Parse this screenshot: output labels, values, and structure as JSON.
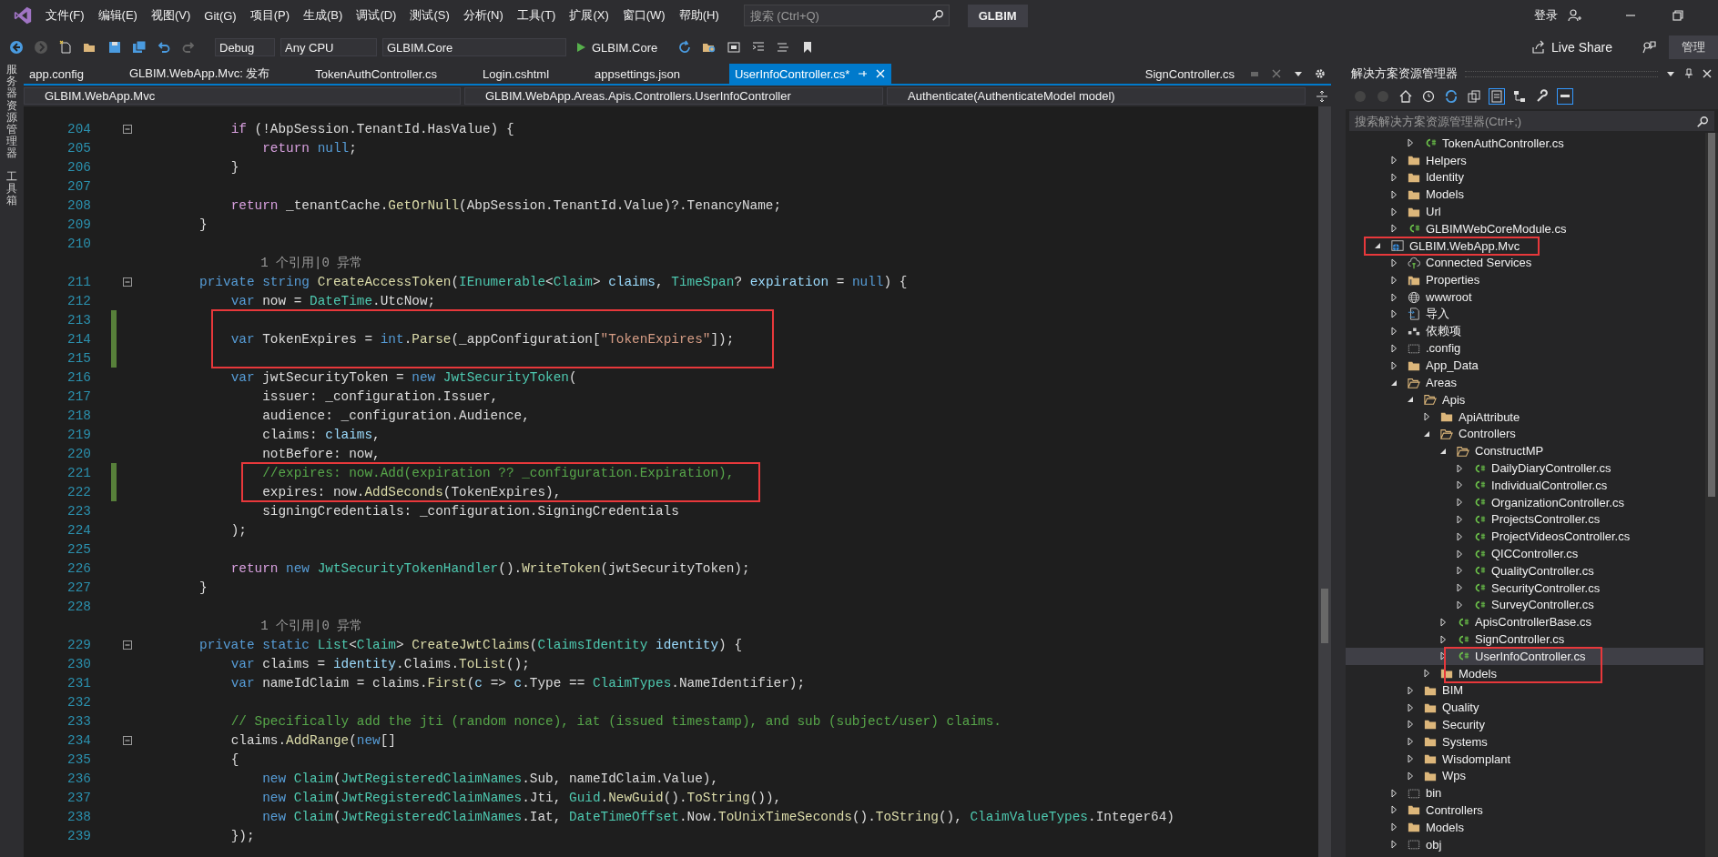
{
  "menu_bar": {
    "items": [
      "文件(F)",
      "编辑(E)",
      "视图(V)",
      "Git(G)",
      "项目(P)",
      "生成(B)",
      "调试(D)",
      "测试(S)",
      "分析(N)",
      "工具(T)",
      "扩展(X)",
      "窗口(W)",
      "帮助(H)"
    ],
    "search": {
      "placeholder": "搜索 (Ctrl+Q)"
    },
    "solution_name": "GLBIM",
    "sign_in": "登录"
  },
  "toolbar": {
    "configuration": "Debug",
    "platform": "Any CPU",
    "startup_project": "GLBIM.Core",
    "run": "GLBIM.Core",
    "live_share": "Live Share",
    "admin": "管理"
  },
  "side_tabs": [
    "服务器资源管理器",
    "工具箱"
  ],
  "editor": {
    "tabs": [
      {
        "label": "app.config",
        "selected": false
      },
      {
        "label": "GLBIM.WebApp.Mvc: 发布",
        "selected": false
      },
      {
        "label": "TokenAuthController.cs",
        "selected": false
      },
      {
        "label": "Login.cshtml",
        "selected": false
      },
      {
        "label": "appsettings.json",
        "selected": false
      },
      {
        "label": "UserInfoController.cs*",
        "selected": true
      }
    ],
    "preview_tab": "SignController.cs",
    "nav": [
      "GLBIM.WebApp.Mvc",
      "GLBIM.WebApp.Areas.Apis.Controllers.UserInfoController",
      "Authenticate(AuthenticateModel model)"
    ],
    "lines": [
      {
        "kind": "code",
        "number": "204",
        "changed": false,
        "fold": true,
        "boxed": false,
        "s": [
          {
            "kind": "control",
            "text": "if"
          },
          {
            "kind": "plain",
            "text": " (!AbpSession.TenantId.HasValue) {"
          }
        ]
      },
      {
        "kind": "code",
        "number": "205",
        "changed": false,
        "fold": false,
        "boxed": false,
        "s": [
          {
            "kind": "control",
            "text": "return "
          },
          {
            "kind": "keyword",
            "text": "null"
          },
          {
            "kind": "plain",
            "text": ";"
          }
        ]
      },
      {
        "kind": "code",
        "number": "206",
        "changed": false,
        "fold": false,
        "boxed": false,
        "s": [
          {
            "kind": "plain",
            "text": "}"
          }
        ]
      },
      {
        "kind": "code",
        "number": "207",
        "changed": false,
        "fold": false,
        "boxed": false
      },
      {
        "kind": "code",
        "number": "208",
        "changed": false,
        "fold": false,
        "boxed": false,
        "s": [
          {
            "kind": "control",
            "text": "return "
          },
          {
            "kind": "plain",
            "text": "_tenantCache."
          },
          {
            "kind": "method",
            "text": "GetOrNull"
          },
          {
            "kind": "plain",
            "text": "(AbpSession.TenantId.Value)?.TenancyName;"
          }
        ]
      },
      {
        "kind": "code",
        "number": "209",
        "changed": false,
        "fold": false,
        "boxed": false,
        "s": [
          {
            "kind": "plain",
            "text": "}"
          }
        ]
      },
      {
        "kind": "code",
        "number": "210",
        "changed": false,
        "fold": false,
        "boxed": false
      },
      {
        "kind": "lens",
        "text": "1 个引用|0 异常",
        "boxed": false
      },
      {
        "kind": "code",
        "number": "211",
        "changed": false,
        "fold": true,
        "boxed": false,
        "s": [
          {
            "kind": "keyword",
            "text": "private string "
          },
          {
            "kind": "method",
            "text": "CreateAccessToken"
          },
          {
            "kind": "plain",
            "text": "("
          },
          {
            "kind": "type",
            "text": "IEnumerable"
          },
          {
            "kind": "plain",
            "text": "<"
          },
          {
            "kind": "type",
            "text": "Claim"
          },
          {
            "kind": "plain",
            "text": "> "
          },
          {
            "kind": "local",
            "text": "claims"
          },
          {
            "kind": "plain",
            "text": ", "
          },
          {
            "kind": "type",
            "text": "TimeSpan"
          },
          {
            "kind": "plain",
            "text": "? "
          },
          {
            "kind": "local",
            "text": "expiration"
          },
          {
            "kind": "plain",
            "text": " = "
          },
          {
            "kind": "keyword",
            "text": "null"
          },
          {
            "kind": "plain",
            "text": ") {"
          }
        ]
      },
      {
        "kind": "code",
        "number": "212",
        "changed": false,
        "fold": false,
        "boxed": false,
        "s": [
          {
            "kind": "keyword",
            "text": "var "
          },
          {
            "kind": "plain",
            "text": "now = "
          },
          {
            "kind": "type",
            "text": "DateTime"
          },
          {
            "kind": "plain",
            "text": ".UtcNow;"
          }
        ]
      },
      {
        "kind": "code",
        "number": "213",
        "changed": true,
        "fold": false,
        "boxed": true
      },
      {
        "kind": "code",
        "number": "214",
        "changed": true,
        "fold": false,
        "boxed": true,
        "s": [
          {
            "kind": "keyword",
            "text": "var "
          },
          {
            "kind": "plain",
            "text": "TokenExpires = "
          },
          {
            "kind": "keyword",
            "text": "int"
          },
          {
            "kind": "plain",
            "text": "."
          },
          {
            "kind": "method",
            "text": "Parse"
          },
          {
            "kind": "plain",
            "text": "(_appConfiguration["
          },
          {
            "kind": "string",
            "text": "\"TokenExpires\""
          },
          {
            "kind": "plain",
            "text": "]);"
          }
        ]
      },
      {
        "kind": "code",
        "number": "215",
        "changed": true,
        "fold": false,
        "boxed": true
      },
      {
        "kind": "code",
        "number": "216",
        "changed": false,
        "fold": false,
        "boxed": false,
        "s": [
          {
            "kind": "keyword",
            "text": "var "
          },
          {
            "kind": "plain",
            "text": "jwtSecurityToken = "
          },
          {
            "kind": "keyword",
            "text": "new "
          },
          {
            "kind": "type",
            "text": "JwtSecurityToken"
          },
          {
            "kind": "plain",
            "text": "("
          }
        ]
      },
      {
        "kind": "code",
        "number": "217",
        "changed": false,
        "fold": false,
        "boxed": false,
        "s": [
          {
            "kind": "plain",
            "text": "issuer: _configuration.Issuer,"
          }
        ]
      },
      {
        "kind": "code",
        "number": "218",
        "changed": false,
        "fold": false,
        "boxed": false,
        "s": [
          {
            "kind": "plain",
            "text": "audience: _configuration.Audience,"
          }
        ]
      },
      {
        "kind": "code",
        "number": "219",
        "changed": false,
        "fold": false,
        "boxed": false,
        "s": [
          {
            "kind": "plain",
            "text": "claims: "
          },
          {
            "kind": "local",
            "text": "claims"
          },
          {
            "kind": "plain",
            "text": ","
          }
        ]
      },
      {
        "kind": "code",
        "number": "220",
        "changed": false,
        "fold": false,
        "boxed": false,
        "s": [
          {
            "kind": "plain",
            "text": "notBefore: now,"
          }
        ]
      },
      {
        "kind": "code",
        "number": "221",
        "changed": true,
        "fold": false,
        "boxed": true,
        "s": [
          {
            "kind": "comment",
            "text": "//expires: now.Add(expiration ?? _configuration.Expiration),"
          }
        ]
      },
      {
        "kind": "code",
        "number": "222",
        "changed": true,
        "fold": false,
        "boxed": true,
        "s": [
          {
            "kind": "plain",
            "text": "expires: now."
          },
          {
            "kind": "method",
            "text": "AddSeconds"
          },
          {
            "kind": "plain",
            "text": "(TokenExpires),"
          }
        ]
      },
      {
        "kind": "code",
        "number": "223",
        "changed": false,
        "fold": false,
        "boxed": false,
        "s": [
          {
            "kind": "plain",
            "text": "signingCredentials: _configuration.SigningCredentials"
          }
        ]
      },
      {
        "kind": "code",
        "number": "224",
        "changed": false,
        "fold": false,
        "boxed": false,
        "s": [
          {
            "kind": "plain",
            "text": ");"
          }
        ]
      },
      {
        "kind": "code",
        "number": "225",
        "changed": false,
        "fold": false,
        "boxed": false
      },
      {
        "kind": "code",
        "number": "226",
        "changed": false,
        "fold": false,
        "boxed": false,
        "s": [
          {
            "kind": "control",
            "text": "return "
          },
          {
            "kind": "keyword",
            "text": "new "
          },
          {
            "kind": "type",
            "text": "JwtSecurityTokenHandler"
          },
          {
            "kind": "plain",
            "text": "()."
          },
          {
            "kind": "method",
            "text": "WriteToken"
          },
          {
            "kind": "plain",
            "text": "(jwtSecurityToken);"
          }
        ]
      },
      {
        "kind": "code",
        "number": "227",
        "changed": false,
        "fold": false,
        "boxed": false,
        "s": [
          {
            "kind": "plain",
            "text": "}"
          }
        ]
      },
      {
        "kind": "code",
        "number": "228",
        "changed": false,
        "fold": false,
        "boxed": false
      },
      {
        "kind": "lens",
        "text": "1 个引用|0 异常",
        "boxed": false
      },
      {
        "kind": "code",
        "number": "229",
        "changed": false,
        "fold": true,
        "boxed": false,
        "s": [
          {
            "kind": "keyword",
            "text": "private static "
          },
          {
            "kind": "type",
            "text": "List"
          },
          {
            "kind": "plain",
            "text": "<"
          },
          {
            "kind": "type",
            "text": "Claim"
          },
          {
            "kind": "plain",
            "text": "> "
          },
          {
            "kind": "method",
            "text": "CreateJwtClaims"
          },
          {
            "kind": "plain",
            "text": "("
          },
          {
            "kind": "type",
            "text": "ClaimsIdentity"
          },
          {
            "kind": "local",
            "text": " identity"
          },
          {
            "kind": "plain",
            "text": ") {"
          }
        ]
      },
      {
        "kind": "code",
        "number": "230",
        "changed": false,
        "fold": false,
        "boxed": false,
        "s": [
          {
            "kind": "keyword",
            "text": "var "
          },
          {
            "kind": "plain",
            "text": "claims = "
          },
          {
            "kind": "local",
            "text": "identity"
          },
          {
            "kind": "plain",
            "text": ".Claims."
          },
          {
            "kind": "method",
            "text": "ToList"
          },
          {
            "kind": "plain",
            "text": "();"
          }
        ]
      },
      {
        "kind": "code",
        "number": "231",
        "changed": false,
        "fold": false,
        "boxed": false,
        "s": [
          {
            "kind": "keyword",
            "text": "var "
          },
          {
            "kind": "plain",
            "text": "nameIdClaim = claims."
          },
          {
            "kind": "method",
            "text": "First"
          },
          {
            "kind": "plain",
            "text": "("
          },
          {
            "kind": "local",
            "text": "c"
          },
          {
            "kind": "plain",
            "text": " => "
          },
          {
            "kind": "local",
            "text": "c"
          },
          {
            "kind": "plain",
            "text": ".Type == "
          },
          {
            "kind": "type",
            "text": "ClaimTypes"
          },
          {
            "kind": "plain",
            "text": ".NameIdentifier);"
          }
        ]
      },
      {
        "kind": "code",
        "number": "232",
        "changed": false,
        "fold": false,
        "boxed": false
      },
      {
        "kind": "code",
        "number": "233",
        "changed": false,
        "fold": false,
        "boxed": false,
        "s": [
          {
            "kind": "comment",
            "text": "// Specifically add the jti (random nonce), iat (issued timestamp), and sub (subject/user) claims."
          }
        ]
      },
      {
        "kind": "code",
        "number": "234",
        "changed": false,
        "fold": true,
        "boxed": false,
        "s": [
          {
            "kind": "plain",
            "text": "claims."
          },
          {
            "kind": "method",
            "text": "AddRange"
          },
          {
            "kind": "plain",
            "text": "("
          },
          {
            "kind": "keyword",
            "text": "new"
          },
          {
            "kind": "plain",
            "text": "[]"
          }
        ]
      },
      {
        "kind": "code",
        "number": "235",
        "changed": false,
        "fold": false,
        "boxed": false,
        "s": [
          {
            "kind": "plain",
            "text": "{"
          }
        ]
      },
      {
        "kind": "code",
        "number": "236",
        "changed": false,
        "fold": false,
        "boxed": false,
        "s": [
          {
            "kind": "keyword",
            "text": "new "
          },
          {
            "kind": "type",
            "text": "Claim"
          },
          {
            "kind": "plain",
            "text": "("
          },
          {
            "kind": "type",
            "text": "JwtRegisteredClaimNames"
          },
          {
            "kind": "plain",
            "text": ".Sub, nameIdClaim.Value),"
          }
        ]
      },
      {
        "kind": "code",
        "number": "237",
        "changed": false,
        "fold": false,
        "boxed": false,
        "s": [
          {
            "kind": "keyword",
            "text": "new "
          },
          {
            "kind": "type",
            "text": "Claim"
          },
          {
            "kind": "plain",
            "text": "("
          },
          {
            "kind": "type",
            "text": "JwtRegisteredClaimNames"
          },
          {
            "kind": "plain",
            "text": ".Jti, "
          },
          {
            "kind": "type",
            "text": "Guid"
          },
          {
            "kind": "plain",
            "text": "."
          },
          {
            "kind": "method",
            "text": "NewGuid"
          },
          {
            "kind": "plain",
            "text": "()."
          },
          {
            "kind": "method",
            "text": "ToString"
          },
          {
            "kind": "plain",
            "text": "()),"
          }
        ]
      },
      {
        "kind": "code",
        "number": "238",
        "changed": false,
        "fold": false,
        "boxed": false,
        "s": [
          {
            "kind": "keyword",
            "text": "new "
          },
          {
            "kind": "type",
            "text": "Claim"
          },
          {
            "kind": "plain",
            "text": "("
          },
          {
            "kind": "type",
            "text": "JwtRegisteredClaimNames"
          },
          {
            "kind": "plain",
            "text": ".Iat, "
          },
          {
            "kind": "type",
            "text": "DateTimeOffset"
          },
          {
            "kind": "plain",
            "text": ".Now."
          },
          {
            "kind": "method",
            "text": "ToUnixTimeSeconds"
          },
          {
            "kind": "plain",
            "text": "()."
          },
          {
            "kind": "method",
            "text": "ToString"
          },
          {
            "kind": "plain",
            "text": "(), "
          },
          {
            "kind": "type",
            "text": "ClaimValueTypes"
          },
          {
            "kind": "plain",
            "text": ".Integer64)"
          }
        ]
      },
      {
        "kind": "code",
        "number": "239",
        "changed": false,
        "fold": false,
        "boxed": false,
        "s": [
          {
            "kind": "plain",
            "text": "});"
          }
        ]
      }
    ]
  },
  "solution_explorer": {
    "title": "解决方案资源管理器",
    "search": {
      "placeholder": "搜索解决方案资源管理器(Ctrl+;)"
    },
    "tree": [
      {
        "children": [
          {
            "children": [
              {
                "label": "TokenAuthController.cs",
                "kind": "cs",
                "expanded": false,
                "selected": false,
                "boxed": false
              }
            ]
          },
          {
            "label": "Helpers",
            "kind": "folder",
            "expanded": false,
            "selected": false,
            "boxed": false
          },
          {
            "label": "Identity",
            "kind": "folder",
            "expanded": false,
            "selected": false,
            "boxed": false
          },
          {
            "label": "Models",
            "kind": "folder",
            "expanded": false,
            "selected": false,
            "boxed": false
          },
          {
            "label": "Url",
            "kind": "folder",
            "expanded": false,
            "selected": false,
            "boxed": false
          },
          {
            "label": "GLBIMWebCoreModule.cs",
            "kind": "cs",
            "expanded": false,
            "selected": false,
            "boxed": false
          }
        ]
      },
      {
        "label": "GLBIM.WebApp.Mvc",
        "kind": "project",
        "expanded": true,
        "selected": false,
        "boxed": true,
        "children": [
          {
            "label": "Connected Services",
            "kind": "service",
            "expanded": false,
            "selected": false,
            "boxed": false
          },
          {
            "label": "Properties",
            "kind": "properties",
            "expanded": false,
            "selected": false,
            "boxed": false
          },
          {
            "label": "wwwroot",
            "kind": "globe",
            "expanded": false,
            "selected": false,
            "boxed": false
          },
          {
            "label": "导入",
            "kind": "import",
            "expanded": false,
            "selected": false,
            "boxed": false
          },
          {
            "label": "依赖项",
            "kind": "deps",
            "expanded": false,
            "selected": false,
            "boxed": false
          },
          {
            "label": ".config",
            "kind": "hidden",
            "expanded": false,
            "selected": false,
            "boxed": false
          },
          {
            "label": "App_Data",
            "kind": "folder",
            "expanded": false,
            "selected": false,
            "boxed": false
          },
          {
            "label": "Areas",
            "kind": "folder",
            "expanded": true,
            "selected": false,
            "boxed": false,
            "children": [
              {
                "label": "Apis",
                "kind": "folder",
                "expanded": true,
                "selected": false,
                "boxed": false,
                "children": [
                  {
                    "label": "ApiAttribute",
                    "kind": "folder",
                    "expanded": false,
                    "selected": false,
                    "boxed": false
                  },
                  {
                    "label": "Controllers",
                    "kind": "folder",
                    "expanded": true,
                    "selected": false,
                    "boxed": false,
                    "children": [
                      {
                        "label": "ConstructMP",
                        "kind": "folder",
                        "expanded": true,
                        "selected": false,
                        "boxed": false,
                        "children": [
                          {
                            "label": "DailyDiaryController.cs",
                            "kind": "cs",
                            "expanded": false,
                            "selected": false,
                            "boxed": false
                          },
                          {
                            "label": "IndividualController.cs",
                            "kind": "cs",
                            "expanded": false,
                            "selected": false,
                            "boxed": false
                          },
                          {
                            "label": "OrganizationController.cs",
                            "kind": "cs",
                            "expanded": false,
                            "selected": false,
                            "boxed": false
                          },
                          {
                            "label": "ProjectsController.cs",
                            "kind": "cs",
                            "expanded": false,
                            "selected": false,
                            "boxed": false
                          },
                          {
                            "label": "ProjectVideosController.cs",
                            "kind": "cs",
                            "expanded": false,
                            "selected": false,
                            "boxed": false
                          },
                          {
                            "label": "QICController.cs",
                            "kind": "cs",
                            "expanded": false,
                            "selected": false,
                            "boxed": false
                          },
                          {
                            "label": "QualityController.cs",
                            "kind": "cs",
                            "expanded": false,
                            "selected": false,
                            "boxed": false
                          },
                          {
                            "label": "SecurityController.cs",
                            "kind": "cs",
                            "expanded": false,
                            "selected": false,
                            "boxed": false
                          },
                          {
                            "label": "SurveyController.cs",
                            "kind": "cs",
                            "expanded": false,
                            "selected": false,
                            "boxed": false
                          }
                        ]
                      },
                      {
                        "label": "ApisControllerBase.cs",
                        "kind": "cs",
                        "expanded": false,
                        "selected": false,
                        "boxed": false
                      },
                      {
                        "label": "SignController.cs",
                        "kind": "cs",
                        "expanded": false,
                        "selected": false,
                        "boxed": false
                      },
                      {
                        "label": "UserInfoController.cs",
                        "kind": "cs",
                        "expanded": false,
                        "selected": true,
                        "boxed": true
                      }
                    ]
                  },
                  {
                    "label": "Models",
                    "kind": "folder",
                    "expanded": false,
                    "selected": false,
                    "boxed": true
                  }
                ]
              },
              {
                "label": "BIM",
                "kind": "folder",
                "expanded": false,
                "selected": false,
                "boxed": false
              },
              {
                "label": "Quality",
                "kind": "folder",
                "expanded": false,
                "selected": false,
                "boxed": false
              },
              {
                "label": "Security",
                "kind": "folder",
                "expanded": false,
                "selected": false,
                "boxed": false
              },
              {
                "label": "Systems",
                "kind": "folder",
                "expanded": false,
                "selected": false,
                "boxed": false
              },
              {
                "label": "Wisdomplant",
                "kind": "folder",
                "expanded": false,
                "selected": false,
                "boxed": false
              },
              {
                "label": "Wps",
                "kind": "folder",
                "expanded": false,
                "selected": false,
                "boxed": false
              }
            ]
          },
          {
            "label": "bin",
            "kind": "hidden",
            "expanded": false,
            "selected": false,
            "boxed": false
          },
          {
            "label": "Controllers",
            "kind": "folder",
            "expanded": false,
            "selected": false,
            "boxed": false
          },
          {
            "label": "Models",
            "kind": "folder",
            "expanded": false,
            "selected": false,
            "boxed": false
          },
          {
            "label": "obj",
            "kind": "hidden",
            "expanded": false,
            "selected": false,
            "boxed": false
          }
        ]
      }
    ]
  }
}
